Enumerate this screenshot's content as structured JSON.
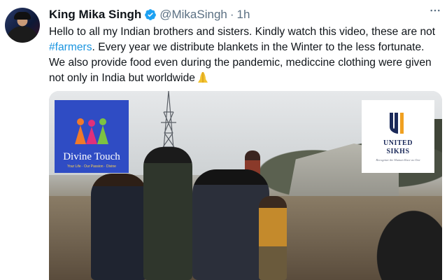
{
  "tweet": {
    "display_name": "King Mika Singh",
    "handle": "@MikaSingh",
    "separator": "·",
    "time": "1h",
    "more_icon": "more-horizontal-icon",
    "verified_icon": "verified-badge-icon",
    "text_part1": "Hello to all my Indian brothers and sisters. Kindly watch this video, these are not ",
    "hashtag": "#farmers",
    "text_part2": ". Every year we distribute blankets in the Winter to the less fortunate. We also provide food even during the pandemic,  mediccine clothing were given not only in India but worldwide",
    "emoji": "folded-hands-emoji"
  },
  "media": {
    "logo_left": {
      "title": "Divine Touch",
      "subtitle": "Your Life · Our Passion · Divine"
    },
    "logo_right": {
      "line1": "UNITED",
      "line2": "SIKHS",
      "subtitle": "Recognize the Human Race as One"
    }
  },
  "colors": {
    "link": "#1b95e0",
    "verified": "#1da1f2",
    "secondary_text": "#5b7083"
  }
}
